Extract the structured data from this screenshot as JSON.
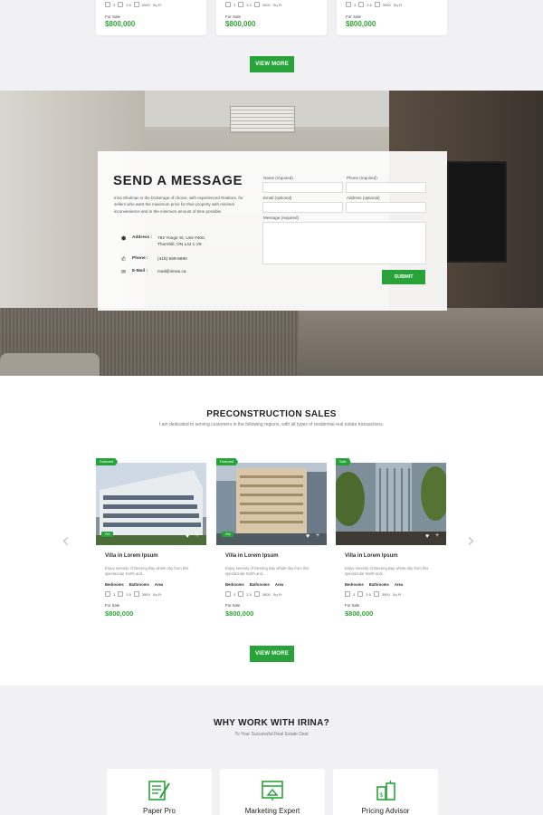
{
  "top_cards": [
    {
      "beds": "3",
      "baths": "3.5",
      "area": "3500",
      "area_unit": "Sq Ft",
      "for_sale": "For Sale",
      "price": "$800,000"
    },
    {
      "beds": "3",
      "baths": "3.5",
      "area": "3500",
      "area_unit": "Sq Ft",
      "for_sale": "For Sale",
      "price": "$800,000"
    },
    {
      "beds": "3",
      "baths": "3.5",
      "area": "3500",
      "area_unit": "Sq Ft",
      "for_sale": "For Sale",
      "price": "$800,000"
    }
  ],
  "top_view_more": "VIEW MORE",
  "message": {
    "title": "SEND A MESSAGE",
    "description": "Irina Shulman is the brokerage of choice, with experienced Realtors, for sellers who want the maximum price for their property with minimal inconvenience and in the minimum amount of time possible.",
    "address_label": "Address :",
    "address_value": "782 Yonge St, Unit #400, Thornhill, ON L4J 1 V8",
    "phone_label": "Phone :",
    "phone_value": "(416) 569-5890",
    "email_label": "E-Mail :",
    "email_value": "mail@irinas.ca",
    "name_label": "Name (required)",
    "phone_field_label": "Phone (required)",
    "email_field_label": "Email (optional)",
    "address_field_label": "Address (optional)",
    "message_label": "Message (required)",
    "submit": "SUBMIT"
  },
  "preconstruction": {
    "title": "PRECONSTRUCTION SALES",
    "subtitle": "I am dedicated to serving customers in the following regions, with all types of residential real estate transactions.",
    "amenity_labels": [
      "Bedrooms",
      "Bathrooms",
      "Area"
    ],
    "cards": [
      {
        "badge": "Featured",
        "hot": "Hot",
        "name": "Villa in Lorem Ipsum",
        "desc": "Enjoy serenity of Deering Bay whole day from this spectacular North and...",
        "beds": "3",
        "baths": "3.5",
        "area": "3500",
        "area_unit": "Sq Ft",
        "for_sale": "For Sale",
        "price": "$800,000"
      },
      {
        "badge": "Featured",
        "hot": "Hot",
        "name": "Villa in Lorem Ipsum",
        "desc": "Enjoy serenity of Deering Bay whole day from this spectacular North and...",
        "beds": "3",
        "baths": "3.5",
        "area": "3500",
        "area_unit": "Sq Ft",
        "for_sale": "For Sale",
        "price": "$800,000"
      },
      {
        "badge": "Sale",
        "hot": "",
        "name": "Villa in Lorem Ipsum",
        "desc": "Enjoy serenity of Deering Bay whole day from this spectacular North and...",
        "beds": "3",
        "baths": "3.5",
        "area": "3500",
        "area_unit": "Sq Ft",
        "for_sale": "For Sale",
        "price": "$800,000"
      }
    ],
    "view_more": "VIEW MORE"
  },
  "why": {
    "title": "WHY WORK WITH IRINA?",
    "subtitle": "To Your Successful Real Estate Deal",
    "cards": [
      {
        "title": "Paper Pro",
        "icon": "certificate-icon"
      },
      {
        "title": "Marketing Expert",
        "icon": "marketing-icon"
      },
      {
        "title": "Pricing Advisor",
        "icon": "pricing-icon"
      }
    ]
  },
  "colors": {
    "accent": "#28a33a",
    "price": "#2ea534"
  }
}
